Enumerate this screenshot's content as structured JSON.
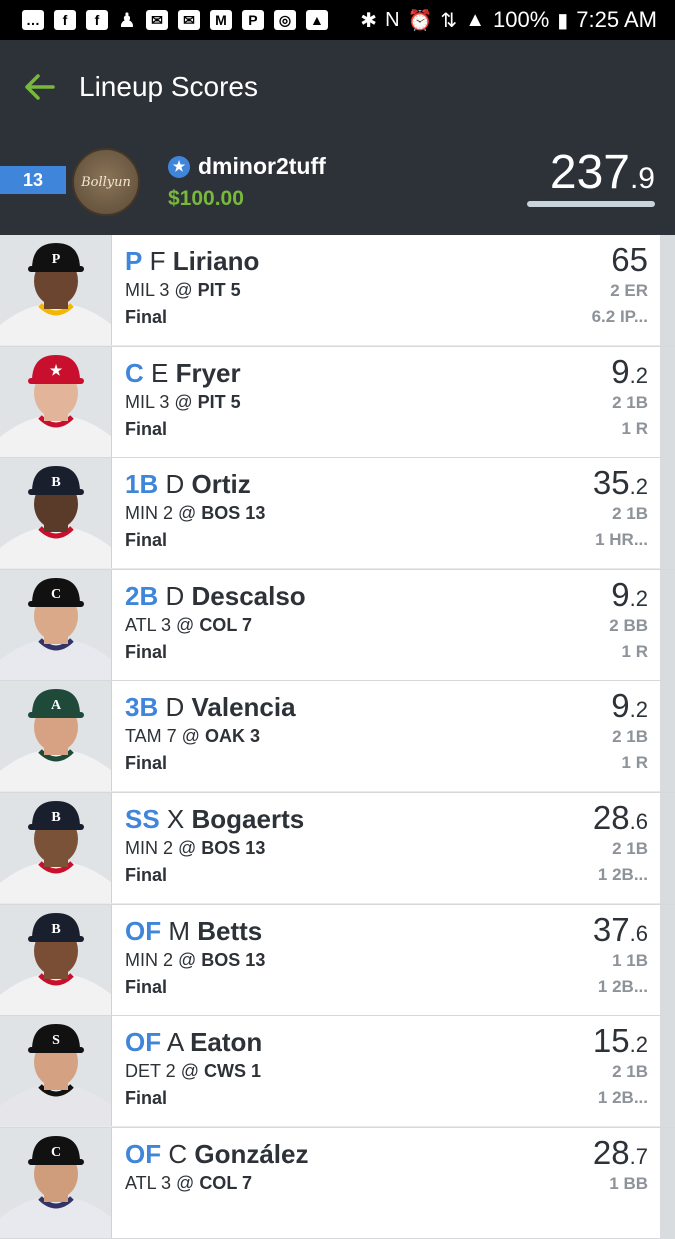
{
  "status_bar": {
    "battery": "100%",
    "time": "7:25 AM"
  },
  "appbar": {
    "title": "Lineup Scores"
  },
  "header": {
    "rank": "13",
    "logo_text": "Bollyun",
    "username": "dminor2tuff",
    "prize": "$100.00",
    "total_int": "237",
    "total_dec": ".9"
  },
  "colors": {
    "accent_blue": "#3f86db",
    "money_green": "#78b83c",
    "dark_bg": "#2d3238"
  },
  "players": [
    {
      "pos": "P",
      "first": "F",
      "last": "Liriano",
      "away": "MIL 3",
      "home": "PIT 5",
      "status": "Final",
      "score_int": "65",
      "score_dec": "",
      "stat1": "2 ER",
      "stat2": "6.2 IP...",
      "cap": "#111111",
      "letter": "P",
      "skin": "#6b4530",
      "jersey": "#f2f2f2",
      "trim": "#f2b705"
    },
    {
      "pos": "C",
      "first": "E",
      "last": "Fryer",
      "away": "MIL 3",
      "home": "PIT 5",
      "status": "Final",
      "score_int": "9",
      "score_dec": ".2",
      "stat1": "2 1B",
      "stat2": "1 R",
      "cap": "#c8102e",
      "letter": "★",
      "skin": "#e2b59a",
      "jersey": "#f2f2f2",
      "trim": "#c8102e"
    },
    {
      "pos": "1B",
      "first": "D",
      "last": "Ortiz",
      "away": "MIN 2",
      "home": "BOS 13",
      "status": "Final",
      "score_int": "35",
      "score_dec": ".2",
      "stat1": "2 1B",
      "stat2": "1 HR...",
      "cap": "#1a1f2e",
      "letter": "B",
      "skin": "#5a3a28",
      "jersey": "#f2f2f2",
      "trim": "#c8102e"
    },
    {
      "pos": "2B",
      "first": "D",
      "last": "Descalso",
      "away": "ATL 3",
      "home": "COL 7",
      "status": "Final",
      "score_int": "9",
      "score_dec": ".2",
      "stat1": "2 BB",
      "stat2": "1 R",
      "cap": "#111111",
      "letter": "C",
      "skin": "#d9a98a",
      "jersey": "#e8e8ef",
      "trim": "#333366"
    },
    {
      "pos": "3B",
      "first": "D",
      "last": "Valencia",
      "away": "TAM 7",
      "home": "OAK 3",
      "status": "Final",
      "score_int": "9",
      "score_dec": ".2",
      "stat1": "2 1B",
      "stat2": "1 R",
      "cap": "#1f4a3a",
      "letter": "A",
      "skin": "#d6a283",
      "jersey": "#f2f2f2",
      "trim": "#1f4a3a"
    },
    {
      "pos": "SS",
      "first": "X",
      "last": "Bogaerts",
      "away": "MIN 2",
      "home": "BOS 13",
      "status": "Final",
      "score_int": "28",
      "score_dec": ".6",
      "stat1": "2 1B",
      "stat2": "1 2B...",
      "cap": "#1a1f2e",
      "letter": "B",
      "skin": "#7a5238",
      "jersey": "#f2f2f2",
      "trim": "#c8102e"
    },
    {
      "pos": "OF",
      "first": "M",
      "last": "Betts",
      "away": "MIN 2",
      "home": "BOS 13",
      "status": "Final",
      "score_int": "37",
      "score_dec": ".6",
      "stat1": "1 1B",
      "stat2": "1 2B...",
      "cap": "#1a1f2e",
      "letter": "B",
      "skin": "#7a4e34",
      "jersey": "#f2f2f2",
      "trim": "#c8102e"
    },
    {
      "pos": "OF",
      "first": "A",
      "last": "Eaton",
      "away": "DET 2",
      "home": "CWS 1",
      "status": "Final",
      "score_int": "15",
      "score_dec": ".2",
      "stat1": "2 1B",
      "stat2": "1 2B...",
      "cap": "#111111",
      "letter": "S",
      "skin": "#d4a182",
      "jersey": "#e6e6ea",
      "trim": "#111111"
    },
    {
      "pos": "OF",
      "first": "C",
      "last": "González",
      "away": "ATL 3",
      "home": "COL 7",
      "status": "",
      "score_int": "28",
      "score_dec": ".7",
      "stat1": "1 BB",
      "stat2": "",
      "cap": "#111111",
      "letter": "C",
      "skin": "#cf9c7c",
      "jersey": "#e8e8ef",
      "trim": "#333366"
    }
  ]
}
